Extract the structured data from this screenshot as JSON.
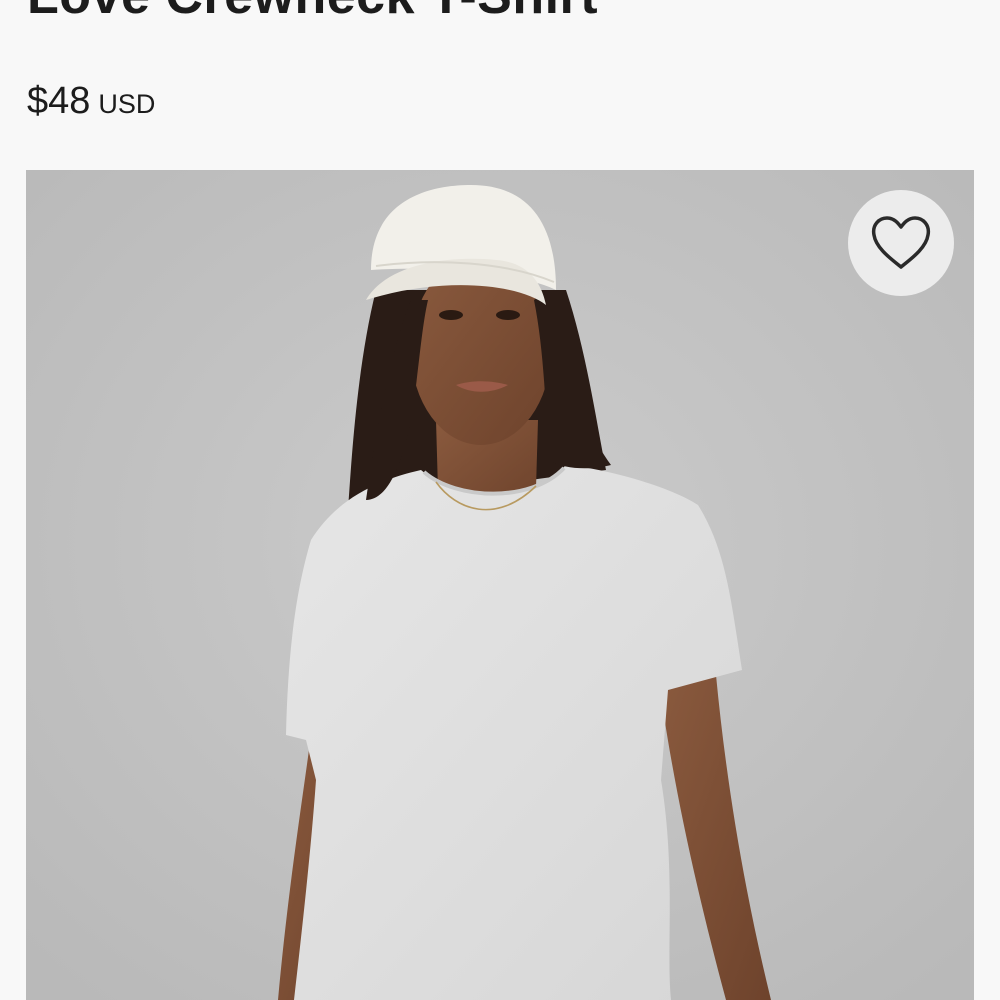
{
  "product": {
    "title": "Love Crewneck T-Shirt",
    "price": "$48",
    "currency": "USD"
  },
  "image": {
    "alt": "Model wearing a light heather grey crewneck t-shirt and a white cap"
  },
  "wishlist": {
    "icon": "heart-outline-icon"
  },
  "colors": {
    "text": "#1c1c1c",
    "page_background": "#f8f8f8",
    "image_background": "#c0c0c0",
    "wishlist_background": "#ececec"
  }
}
